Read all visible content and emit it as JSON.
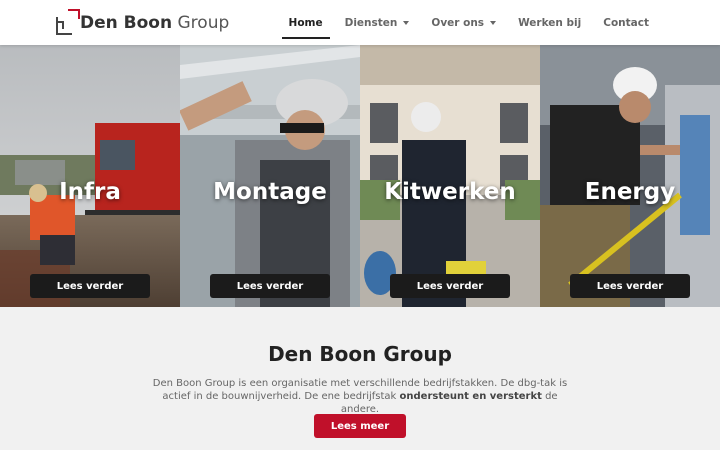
{
  "logo": {
    "bold": "Den Boon",
    "light": "Group",
    "brand_color": "#c0102a"
  },
  "nav": {
    "items": [
      {
        "label": "Home",
        "active": true
      },
      {
        "label": "Diensten",
        "dropdown": true
      },
      {
        "label": "Over ons",
        "dropdown": true
      },
      {
        "label": "Werken bij"
      },
      {
        "label": "Contact"
      }
    ]
  },
  "tiles": [
    {
      "title": "Infra",
      "button": "Lees verder"
    },
    {
      "title": "Montage",
      "button": "Lees verder"
    },
    {
      "title": "Kitwerken",
      "button": "Lees verder"
    },
    {
      "title": "Energy",
      "button": "Lees verder"
    }
  ],
  "intro": {
    "heading": "Den Boon Group",
    "text_part1": "Den Boon Group is een organisatie met verschillende bedrijfstakken. De dbg-tak is actief in de bouwnijverheid. De ene bedrijfstak ",
    "text_bold": "ondersteunt en versterkt",
    "text_part2": " de andere.",
    "cta": "Lees meer"
  }
}
